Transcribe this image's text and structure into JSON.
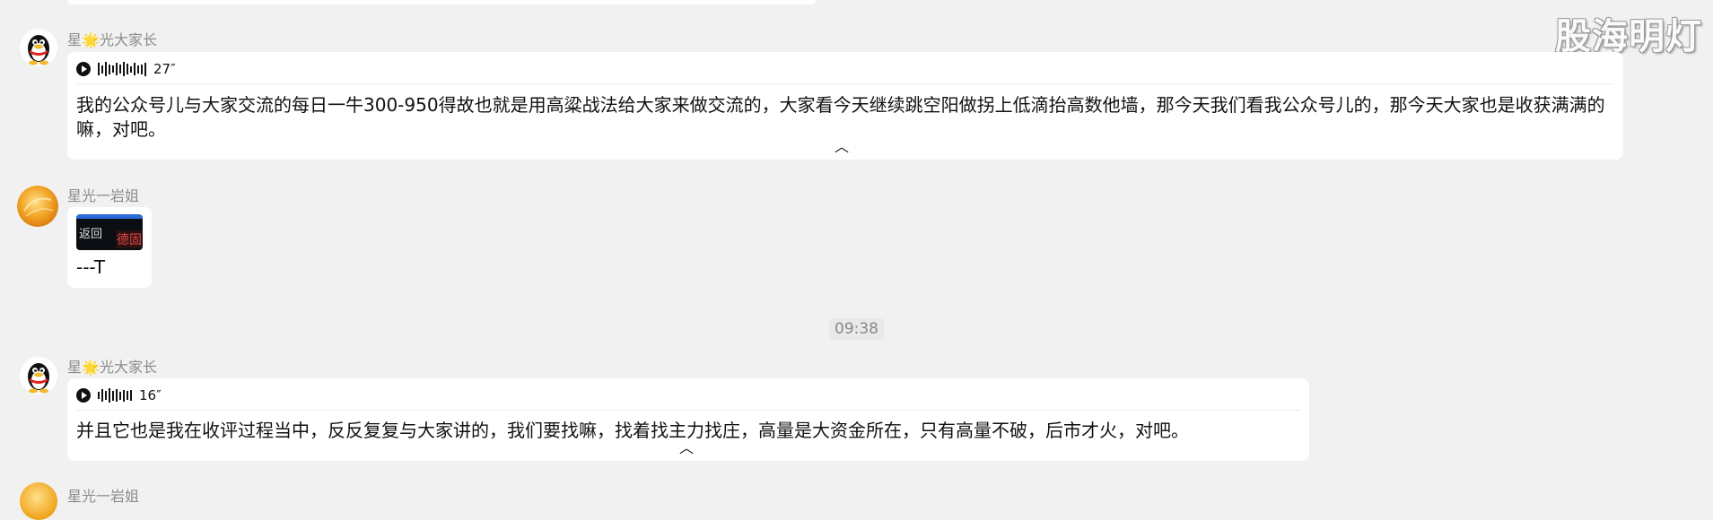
{
  "watermark": "股海明灯",
  "messages": [
    {
      "sender": {
        "prefix": "星",
        "star": "🌟",
        "suffix": "光大家长"
      },
      "voice_duration": "27″",
      "text": "我的公众号儿与大家交流的每日一牛300-950得故也就是用高粱战法给大家来做交流的，大家看今天继续跳空阳做拐上低滴抬高数他墙，那今天我们看我公众号儿的，那今天大家也是收获满满的嘛，对吧。"
    },
    {
      "sender": {
        "name": "星光一岩姐"
      },
      "image_text": {
        "back": "返回",
        "tag": "德固"
      },
      "text": "---T"
    },
    {
      "sender": {
        "prefix": "星",
        "star": "🌟",
        "suffix": "光大家长"
      },
      "voice_duration": "16″",
      "text": "并且它也是我在收评过程当中，反反复复与大家讲的，我们要找嘛，找着找主力找庄，高量是大资金所在，只有高量不破，后市才火，对吧。"
    }
  ],
  "timestamp": "09:38",
  "next_sender": "星光一岩姐"
}
